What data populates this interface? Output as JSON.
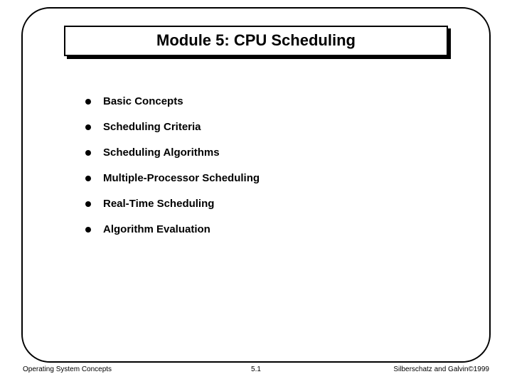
{
  "title": "Module 5:  CPU Scheduling",
  "bullets": [
    "Basic Concepts",
    "Scheduling Criteria",
    "Scheduling Algorithms",
    "Multiple-Processor Scheduling",
    "Real-Time Scheduling",
    "Algorithm Evaluation"
  ],
  "footer": {
    "left": "Operating System Concepts",
    "center": "5.1",
    "right": "Silberschatz and Galvin©1999"
  }
}
